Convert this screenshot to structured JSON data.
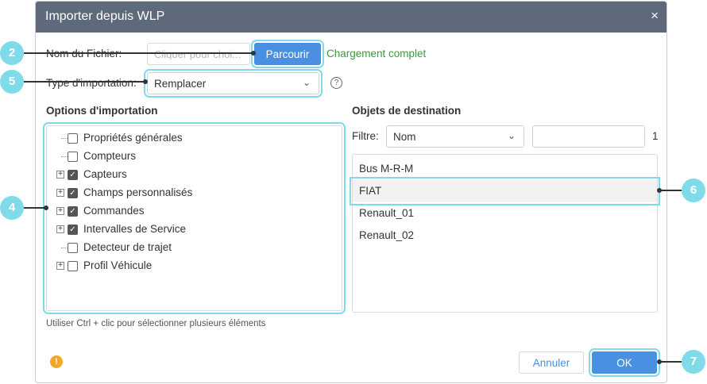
{
  "dialog": {
    "title": "Importer depuis WLP",
    "close_icon": "×",
    "file_label": "Nom du Fichier:",
    "file_placeholder": "Cliquer pour choi...",
    "browse_label": "Parcourir",
    "status_text": "Chargement complet",
    "import_type_label": "Type d'importation:",
    "import_type_value": "Remplacer",
    "help_icon": "?",
    "options_heading": "Options d'importation",
    "options": [
      {
        "label": "Propriétés générales",
        "checked": false,
        "expandable": false
      },
      {
        "label": "Compteurs",
        "checked": false,
        "expandable": false
      },
      {
        "label": "Capteurs",
        "checked": true,
        "expandable": true
      },
      {
        "label": "Champs personnalisés",
        "checked": true,
        "expandable": true
      },
      {
        "label": "Commandes",
        "checked": true,
        "expandable": true
      },
      {
        "label": "Intervalles de Service",
        "checked": true,
        "expandable": true
      },
      {
        "label": "Detecteur de trajet",
        "checked": false,
        "expandable": false
      },
      {
        "label": "Profil Véhicule",
        "checked": false,
        "expandable": true
      }
    ],
    "destination_heading": "Objets de destination",
    "filter_label": "Filtre:",
    "filter_value": "Nom",
    "filter_input_value": "",
    "count": "1",
    "objects": [
      "Bus M-R-M",
      "FIAT",
      "Renault_01",
      "Renault_02"
    ],
    "selected_object": "FIAT",
    "hint": "Utiliser Ctrl + clic pour sélectionner plusieurs éléments",
    "warning_icon": "!",
    "cancel_label": "Annuler",
    "ok_label": "OK"
  },
  "callouts": {
    "c2": "2",
    "c5": "5",
    "c4": "4",
    "c6": "6",
    "c7": "7"
  },
  "colors": {
    "titlebar": "#5e6a7c",
    "primary": "#4a90e2",
    "success": "#3c9a3c",
    "callout": "#7fdbea",
    "warning": "#f5a623"
  }
}
